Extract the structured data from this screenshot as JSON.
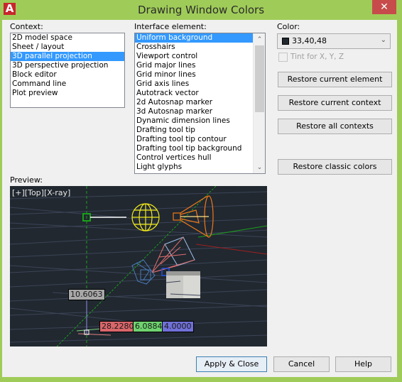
{
  "window": {
    "title": "Drawing Window Colors",
    "app_icon": "autocad-icon",
    "close_glyph": "✕"
  },
  "context": {
    "label": "Context:",
    "items": [
      {
        "label": "2D model space",
        "selected": false
      },
      {
        "label": "Sheet / layout",
        "selected": false
      },
      {
        "label": "3D parallel projection",
        "selected": true
      },
      {
        "label": "3D perspective projection",
        "selected": false
      },
      {
        "label": "Block editor",
        "selected": false
      },
      {
        "label": "Command line",
        "selected": false
      },
      {
        "label": "Plot preview",
        "selected": false
      }
    ]
  },
  "interface_element": {
    "label": "Interface element:",
    "items": [
      {
        "label": "Uniform background",
        "selected": true
      },
      {
        "label": "Crosshairs",
        "selected": false
      },
      {
        "label": "Viewport control",
        "selected": false
      },
      {
        "label": "Grid major lines",
        "selected": false
      },
      {
        "label": "Grid minor lines",
        "selected": false
      },
      {
        "label": "Grid axis lines",
        "selected": false
      },
      {
        "label": "Autotrack vector",
        "selected": false
      },
      {
        "label": "2d Autosnap marker",
        "selected": false
      },
      {
        "label": "3d Autosnap marker",
        "selected": false
      },
      {
        "label": "Dynamic dimension lines",
        "selected": false
      },
      {
        "label": "Drafting tool tip",
        "selected": false
      },
      {
        "label": "Drafting tool tip contour",
        "selected": false
      },
      {
        "label": "Drafting tool tip background",
        "selected": false
      },
      {
        "label": "Control vertices hull",
        "selected": false
      },
      {
        "label": "Light glyphs",
        "selected": false
      }
    ],
    "scroll_up_glyph": "⌃",
    "scroll_down_glyph": "⌄"
  },
  "color": {
    "label": "Color:",
    "value": "33,40,48",
    "swatch": "#212830",
    "dropdown_glyph": "⌄",
    "tint_label": "Tint for X, Y, Z",
    "tint_checked": false,
    "tint_enabled": false
  },
  "buttons": {
    "restore_current_element": "Restore current element",
    "restore_current_context": "Restore current context",
    "restore_all_contexts": "Restore all contexts",
    "restore_classic_colors": "Restore classic colors",
    "apply_close": "Apply & Close",
    "cancel": "Cancel",
    "help": "Help"
  },
  "preview": {
    "label": "Preview:",
    "viewport_label": "[+][Top][X-ray]",
    "background": "#212830",
    "dimensions": {
      "z_value": "10.6063",
      "x_value": "28.2280",
      "y_value": "6.0884",
      "w_value": "4.0000"
    },
    "colors": {
      "x_box": "#d9666a",
      "y_box": "#6fd36f",
      "z_box": "#7070d8",
      "neutral_box": "#a8a8a8"
    }
  }
}
